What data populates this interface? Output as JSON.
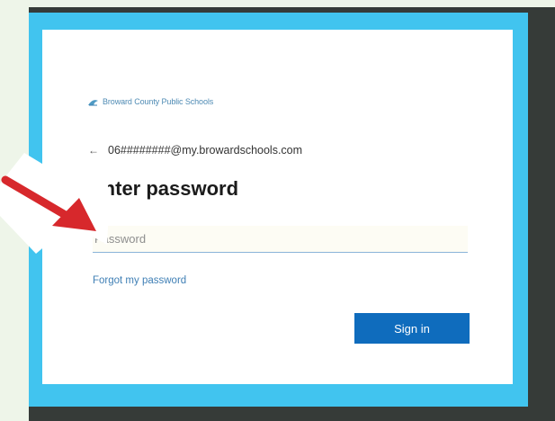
{
  "colors": {
    "page_bg": "#eef5e9",
    "dark_panel": "#363b38",
    "frame": "#41c4ef",
    "card": "#ffffff",
    "accent": "#0f6cbd",
    "link": "#3f7fb5",
    "annotation_arrow": "#d7282c"
  },
  "logo": {
    "icon": "district-logo-icon",
    "text": "Broward County Public Schools"
  },
  "identity": {
    "back_icon": "back-arrow-icon",
    "email": "06########@my.browardschools.com"
  },
  "title": "Enter password",
  "password": {
    "placeholder": "Password",
    "value": ""
  },
  "forgot_link": "Forgot my password",
  "signin_button": "Sign in",
  "annotation": {
    "icon": "red-arrow-icon"
  }
}
